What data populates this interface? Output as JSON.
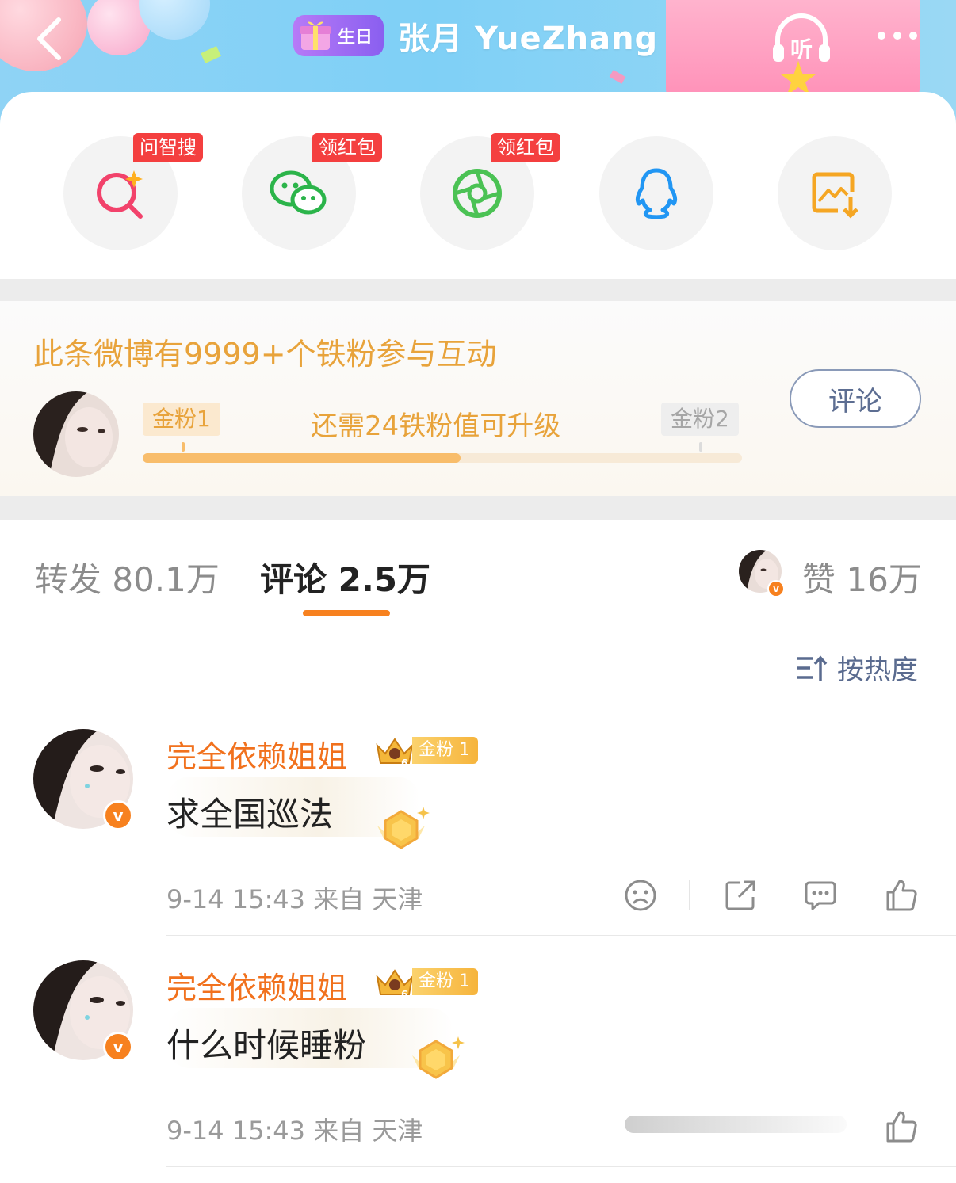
{
  "header": {
    "birthday_badge": "生日",
    "title": "张月 YueZhang",
    "listen_label": "听"
  },
  "share": {
    "items": [
      {
        "icon": "ai-search-icon",
        "tag": "问智搜"
      },
      {
        "icon": "wechat-icon",
        "tag": "领红包"
      },
      {
        "icon": "moments-icon",
        "tag": "领红包"
      },
      {
        "icon": "qq-icon",
        "tag": ""
      },
      {
        "icon": "save-image-icon",
        "tag": ""
      }
    ]
  },
  "fans": {
    "headline": "此条微博有9999+个铁粉参与互动",
    "current_level": "金粉1",
    "next_level": "金粉2",
    "upgrade_hint": "还需24铁粉值可升级",
    "progress": 0.53,
    "comment_button": "评论"
  },
  "tabs": {
    "repost": "转发 80.1万",
    "comment": "评论 2.5万",
    "like": "赞 16万",
    "active": "comment"
  },
  "sort": {
    "label": "按热度"
  },
  "comments": [
    {
      "name": "完全依赖姐姐",
      "fan_badge": "金粉 1",
      "text": "求全国巡法",
      "meta": "9-14 15:43  来自 天津"
    },
    {
      "name": "完全依赖姐姐",
      "fan_badge": "金粉 1",
      "text": "什么时候睡粉",
      "meta": "9-14 15:43  来自 天津"
    }
  ],
  "colors": {
    "accent_orange": "#f7811f",
    "fan_gold": "#e8a33b",
    "link_blue": "#5a6b8f",
    "red_tag": "#f43f3f"
  }
}
